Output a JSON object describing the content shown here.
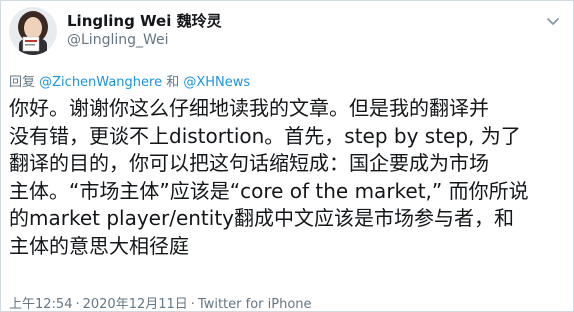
{
  "tweet": {
    "author": {
      "display_name": "Lingling Wei 魏玲灵",
      "handle": "@Lingling_Wei"
    },
    "reply_to": {
      "prefix": "回复",
      "mention_1": "@ZichenWanghere",
      "conjunction": "和",
      "mention_2": "@XHNews"
    },
    "text_lines": [
      "你好。谢谢你这么仔细地读我的文章。但是我的翻译并",
      "没有错，更谈不上distortion。首先，step by step, 为了",
      "翻译的目的，你可以把这句话缩短成：国企要成为市场",
      "主体。“市场主体”应该是“core of the market,” 而你所说",
      "的market player/entity翻成中文应该是市场参与者，和",
      "主体的意思大相径庭"
    ],
    "meta": {
      "time": "上午12:54",
      "separator": "·",
      "date": "2020年12月11日",
      "source": "Twitter for iPhone"
    },
    "colors": {
      "link": "#1b95e0",
      "secondary_text": "#657786",
      "primary_text": "#14171a"
    },
    "icons": {
      "avatar": "profile-photo",
      "menu": "chevron-down-icon"
    }
  }
}
